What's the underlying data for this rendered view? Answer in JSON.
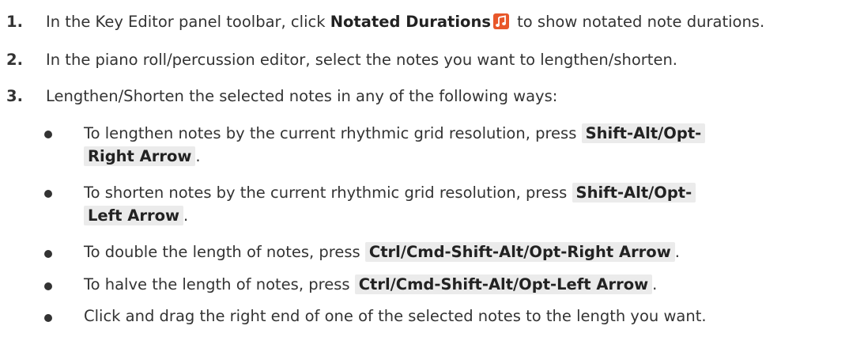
{
  "steps": [
    {
      "num": "1.",
      "pre": "In the Key Editor panel toolbar, click ",
      "bold": "Notated Durations",
      "icon": "note-icon",
      "post": " to show notated note durations."
    },
    {
      "num": "2.",
      "text": "In the piano roll/percussion editor, select the notes you want to lengthen/shorten."
    },
    {
      "num": "3.",
      "text": "Lengthen/Shorten the selected notes in any of the following ways:"
    }
  ],
  "bullets": [
    {
      "pre": "To lengthen notes by the current rhythmic grid resolution, press ",
      "key_line1": "Shift-Alt/Opt-",
      "key_line2": "Right Arrow",
      "post": "."
    },
    {
      "pre": "To shorten notes by the current rhythmic grid resolution, press ",
      "key_line1": "Shift-Alt/Opt-",
      "key_line2": "Left Arrow",
      "post": "."
    },
    {
      "pre": "To double the length of notes, press ",
      "key": "Ctrl/Cmd-Shift-Alt/Opt-Right Arrow",
      "post": "."
    },
    {
      "pre": "To halve the length of notes, press ",
      "key": "Ctrl/Cmd-Shift-Alt/Opt-Left Arrow",
      "post": "."
    },
    {
      "text": "Click and drag the right end of one of the selected notes to the length you want."
    }
  ],
  "colors": {
    "icon_bg": "#e8572a",
    "key_bg": "#ebebeb",
    "text": "#333333"
  }
}
